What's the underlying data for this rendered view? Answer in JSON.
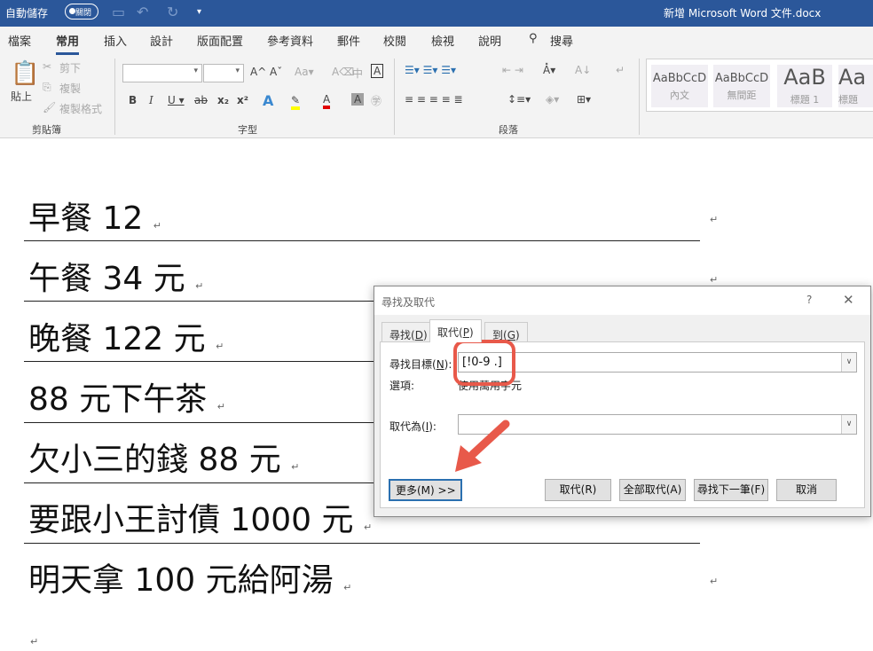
{
  "titlebar": {
    "autosave": "自動儲存",
    "autosave_state": "關閉",
    "doc_title": "新增 Microsoft Word 文件.docx"
  },
  "tabs": [
    "檔案",
    "常用",
    "插入",
    "設計",
    "版面配置",
    "參考資料",
    "郵件",
    "校閱",
    "檢視",
    "說明",
    "搜尋"
  ],
  "ribbon": {
    "paste": "貼上",
    "cut": "剪下",
    "copy": "複製",
    "format_painter": "複製格式",
    "clipboard_group": "剪貼簿",
    "font_group": "字型",
    "paragraph_group": "段落",
    "styles": [
      {
        "preview": "AaBbCcD",
        "name": "內文"
      },
      {
        "preview": "AaBbCcD",
        "name": "無間距"
      },
      {
        "preview": "AaB",
        "name": "標題 1"
      },
      {
        "preview": "Aa",
        "name": "標題"
      }
    ],
    "colors": {
      "highlight": "#ffff00",
      "font_color": "#e00000",
      "accent": "#2b579a"
    }
  },
  "document": {
    "lines": [
      "早餐 12",
      "午餐 34 元",
      "晚餐 122  元",
      "88 元下午茶",
      "欠小三的錢 88 元",
      "要跟小王討債 1000 元",
      "明天拿 100 元給阿湯"
    ],
    "para_mark": "↵"
  },
  "dialog": {
    "title": "尋找及取代",
    "help": "?",
    "close": "✕",
    "tabs": [
      {
        "label": "尋找(",
        "key": "D"
      },
      {
        "label": "取代(",
        "key": "P"
      },
      {
        "label": "到(",
        "key": "G"
      }
    ],
    "find_label": "尋找目標(",
    "find_key": "N",
    "find_value": "[!0-9 .]",
    "options_label": "選項:",
    "options_value": "使用萬用字元",
    "replace_label": "取代為(",
    "replace_key": "I",
    "replace_value": "",
    "buttons": {
      "more": "更多(M) >>",
      "replace": "取代(R)",
      "replace_all": "全部取代(A)",
      "find_next": "尋找下一筆(F)",
      "cancel": "取消"
    }
  }
}
